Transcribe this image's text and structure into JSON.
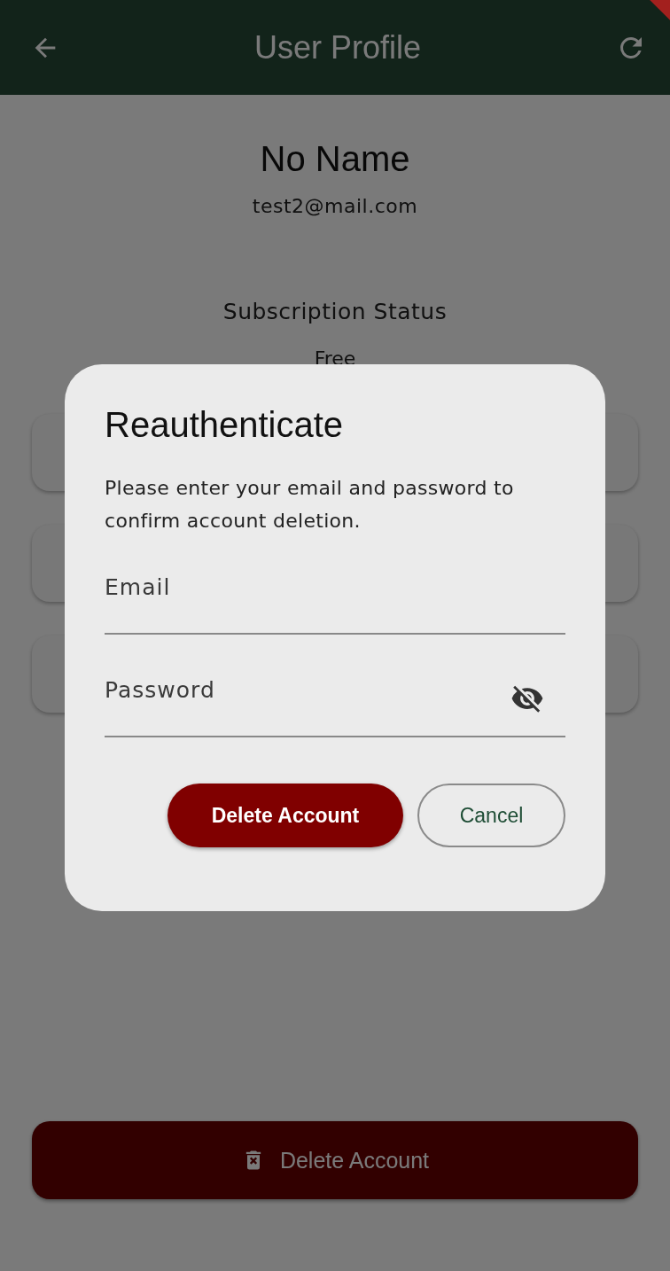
{
  "app_bar": {
    "title": "User Profile"
  },
  "profile": {
    "name": "No Name",
    "email": "test2@mail.com",
    "subscription_label": "Subscription Status",
    "subscription_value": "Free"
  },
  "delete_button": {
    "label": "Delete Account"
  },
  "dialog": {
    "title": "Reauthenticate",
    "message": "Please enter your email and password to confirm account deletion.",
    "fields": [
      {
        "kind": "text",
        "placeholder": "Email"
      },
      {
        "kind": "password",
        "placeholder": "Password",
        "obscured": true
      }
    ],
    "buttons": [
      {
        "kind": "filled",
        "label": "Delete Account"
      },
      {
        "kind": "outlined",
        "label": "Cancel"
      }
    ]
  }
}
